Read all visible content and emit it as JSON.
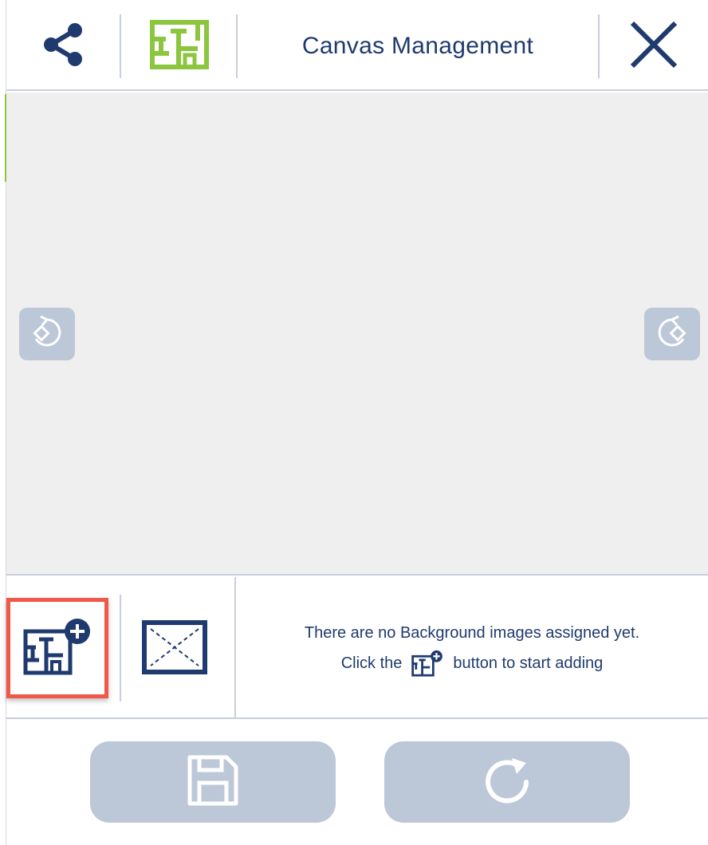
{
  "header": {
    "title": "Canvas Management",
    "share_icon": "share-icon",
    "canvas_icon": "floorplan-icon",
    "close_icon": "close-icon"
  },
  "canvas": {
    "rotate_left_icon": "rotate-left-icon",
    "rotate_right_icon": "rotate-right-icon"
  },
  "toolbar": {
    "add_icon": "add-background-icon",
    "remove_icon": "remove-background-icon",
    "message_line1": "There are no Background images assigned yet.",
    "message_prefix": "Click the",
    "message_suffix": "button to start adding"
  },
  "footer": {
    "save_icon": "save-icon",
    "reset_icon": "reset-icon"
  },
  "colors": {
    "brand_navy": "#1f3a6e",
    "accent_green": "#8cc63f",
    "highlight_red": "#f0584a",
    "disabled_button": "#bcc7d8",
    "canvas_bg": "#efefef"
  }
}
